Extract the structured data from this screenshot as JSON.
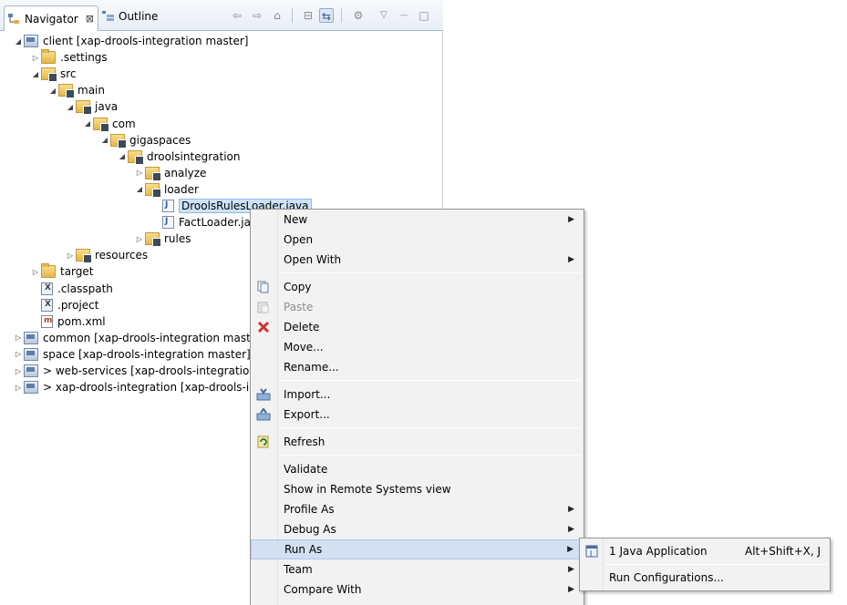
{
  "navigator_tab": {
    "label": "Navigator",
    "close": "⊠"
  },
  "outline_tab": {
    "label": "Outline"
  },
  "toolbar": {
    "back": "⇦",
    "forward": "⇨",
    "home": "⌂",
    "collapse": "⊟",
    "link": "⇆",
    "filter": "⚙",
    "view_menu": "▽",
    "minimize": "—",
    "maximize": "□"
  },
  "tree": [
    {
      "label": "client  [xap-drools-integration master]",
      "depth": 0,
      "toggle": "◢",
      "icon": "project"
    },
    {
      "label": ".settings",
      "depth": 1,
      "toggle": "▷",
      "icon": "folder"
    },
    {
      "label": "src",
      "depth": 1,
      "toggle": "◢",
      "icon": "package-folder"
    },
    {
      "label": "main",
      "depth": 2,
      "toggle": "◢",
      "icon": "package-folder"
    },
    {
      "label": "java",
      "depth": 3,
      "toggle": "◢",
      "icon": "package-folder"
    },
    {
      "label": "com",
      "depth": 4,
      "toggle": "◢",
      "icon": "package-folder"
    },
    {
      "label": "gigaspaces",
      "depth": 5,
      "toggle": "◢",
      "icon": "package-folder"
    },
    {
      "label": "droolsintegration",
      "depth": 6,
      "toggle": "◢",
      "icon": "package-folder"
    },
    {
      "label": "analyze",
      "depth": 7,
      "toggle": "▷",
      "icon": "package-folder"
    },
    {
      "label": "loader",
      "depth": 7,
      "toggle": "◢",
      "icon": "package-folder"
    },
    {
      "label": "DroolsRulesLoader.java",
      "depth": 8,
      "toggle": "",
      "icon": "java-file",
      "selected": true
    },
    {
      "label": "FactLoader.java",
      "depth": 8,
      "toggle": "",
      "icon": "java-file"
    },
    {
      "label": "rules",
      "depth": 7,
      "toggle": "▷",
      "icon": "package-folder"
    },
    {
      "label": "resources",
      "depth": 3,
      "toggle": "▷",
      "icon": "package-folder"
    },
    {
      "label": "target",
      "depth": 1,
      "toggle": "▷",
      "icon": "folder"
    },
    {
      "label": ".classpath",
      "depth": 1,
      "toggle": "",
      "icon": "xml-file"
    },
    {
      "label": ".project",
      "depth": 1,
      "toggle": "",
      "icon": "xml-file"
    },
    {
      "label": "pom.xml",
      "depth": 1,
      "toggle": "",
      "icon": "maven-file"
    },
    {
      "label": "common  [xap-drools-integration master]",
      "depth": 0,
      "toggle": "▷",
      "icon": "project"
    },
    {
      "label": "space  [xap-drools-integration master]",
      "depth": 0,
      "toggle": "▷",
      "icon": "project"
    },
    {
      "label": "> web-services  [xap-drools-integration master]",
      "depth": 0,
      "toggle": "▷",
      "icon": "project"
    },
    {
      "label": "> xap-drools-integration  [xap-drools-integration master]",
      "depth": 0,
      "toggle": "▷",
      "icon": "project"
    }
  ],
  "context_menu": {
    "items": [
      {
        "label": "New",
        "submenu": true
      },
      {
        "label": "Open"
      },
      {
        "label": "Open With",
        "submenu": true
      },
      {
        "label": "Copy",
        "icon": "copy-icon"
      },
      {
        "label": "Paste",
        "icon": "paste-icon",
        "disabled": true
      },
      {
        "label": "Delete",
        "icon": "delete-icon"
      },
      {
        "label": "Move..."
      },
      {
        "label": "Rename..."
      },
      {
        "label": "Import...",
        "icon": "import-icon"
      },
      {
        "label": "Export...",
        "icon": "export-icon"
      },
      {
        "label": "Refresh",
        "icon": "refresh-icon"
      },
      {
        "label": "Validate"
      },
      {
        "label": "Show in Remote Systems view"
      },
      {
        "label": "Profile As",
        "submenu": true
      },
      {
        "label": "Debug As",
        "submenu": true
      },
      {
        "label": "Run As",
        "submenu": true,
        "highlighted": true
      },
      {
        "label": "Team",
        "submenu": true
      },
      {
        "label": "Compare With",
        "submenu": true
      }
    ]
  },
  "run_as_submenu": {
    "items": [
      {
        "label": "1 Java Application",
        "accelerator": "Alt+Shift+X, J",
        "icon": "java-app-icon"
      },
      {
        "label": "Run Configurations..."
      }
    ]
  }
}
